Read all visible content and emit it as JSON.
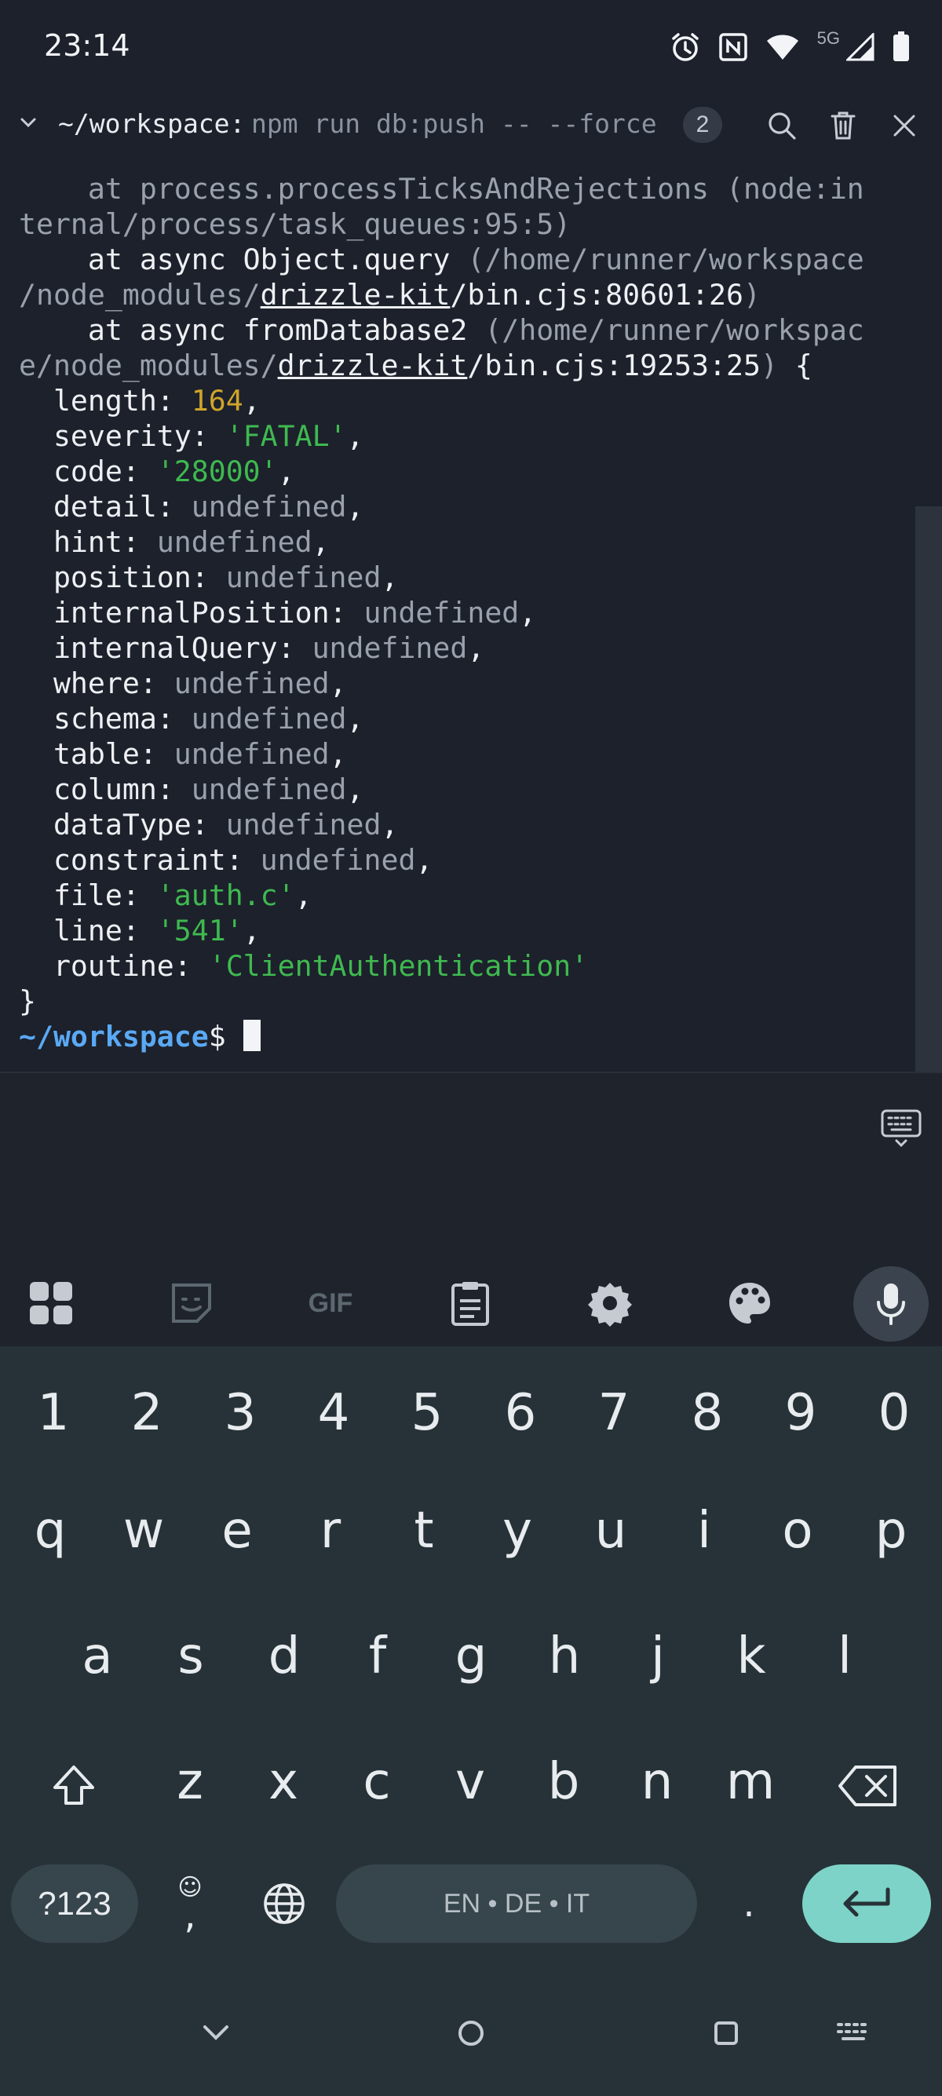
{
  "status_bar": {
    "time": "23:14",
    "network": "5G",
    "icons": [
      "alarm-icon",
      "nfc-icon",
      "wifi-icon",
      "signal-icon",
      "battery-icon"
    ]
  },
  "terminal": {
    "cwd": "~/workspace:",
    "command": "npm run db:push -- --force",
    "session_count": "2",
    "lines": {
      "l1a": "    at process.processTicksAndRejections (node:in",
      "l1b": "ternal/process/task_queues:95:5)",
      "l2a_at": "    at async Object.query ",
      "l2a_path": "(/home/runner/workspace",
      "l2b_p1": "/node_modules/",
      "l2b_link": "drizzle-kit",
      "l2b_p2": "/bin.cjs:80601:26",
      "l2b_end": ")",
      "l3a_at": "    at async fromDatabase2 ",
      "l3a_path": "(/home/runner/workspac",
      "l3b_p1": "e/node_modules/",
      "l3b_link": "drizzle-kit",
      "l3b_p2": "/bin.cjs:19253:25",
      "l3b_end": ")",
      "l3b_brace": " {"
    },
    "fields": [
      {
        "key": "  length: ",
        "value": "164",
        "kind": "num",
        "sep": ","
      },
      {
        "key": "  severity: ",
        "value": "'FATAL'",
        "kind": "str",
        "sep": ","
      },
      {
        "key": "  code: ",
        "value": "'28000'",
        "kind": "str",
        "sep": ","
      },
      {
        "key": "  detail: ",
        "value": "undefined",
        "kind": "dim",
        "sep": ","
      },
      {
        "key": "  hint: ",
        "value": "undefined",
        "kind": "dim",
        "sep": ","
      },
      {
        "key": "  position: ",
        "value": "undefined",
        "kind": "dim",
        "sep": ","
      },
      {
        "key": "  internalPosition: ",
        "value": "undefined",
        "kind": "dim",
        "sep": ","
      },
      {
        "key": "  internalQuery: ",
        "value": "undefined",
        "kind": "dim",
        "sep": ","
      },
      {
        "key": "  where: ",
        "value": "undefined",
        "kind": "dim",
        "sep": ","
      },
      {
        "key": "  schema: ",
        "value": "undefined",
        "kind": "dim",
        "sep": ","
      },
      {
        "key": "  table: ",
        "value": "undefined",
        "kind": "dim",
        "sep": ","
      },
      {
        "key": "  column: ",
        "value": "undefined",
        "kind": "dim",
        "sep": ","
      },
      {
        "key": "  dataType: ",
        "value": "undefined",
        "kind": "dim",
        "sep": ","
      },
      {
        "key": "  constraint: ",
        "value": "undefined",
        "kind": "dim",
        "sep": ","
      },
      {
        "key": "  file: ",
        "value": "'auth.c'",
        "kind": "str",
        "sep": ","
      },
      {
        "key": "  line: ",
        "value": "'541'",
        "kind": "str",
        "sep": ","
      },
      {
        "key": "  routine: ",
        "value": "'ClientAuthentication'",
        "kind": "str",
        "sep": ""
      }
    ],
    "closing_brace": "}",
    "prompt": "~/workspace",
    "prompt_symbol": "$ "
  },
  "keyboard": {
    "toolbar": [
      "apps-icon",
      "sticker-icon",
      "GIF",
      "clipboard-icon",
      "settings-icon",
      "palette-icon",
      "mic-icon"
    ],
    "gif_label": "GIF",
    "row_numbers": [
      "1",
      "2",
      "3",
      "4",
      "5",
      "6",
      "7",
      "8",
      "9",
      "0"
    ],
    "row1": [
      "q",
      "w",
      "e",
      "r",
      "t",
      "y",
      "u",
      "i",
      "o",
      "p"
    ],
    "row2": [
      "a",
      "s",
      "d",
      "f",
      "g",
      "h",
      "j",
      "k",
      "l"
    ],
    "row3": [
      "z",
      "x",
      "c",
      "v",
      "b",
      "n",
      "m"
    ],
    "symbols_label": "?123",
    "comma_label": ",",
    "period_label": ".",
    "space_label": "EN • DE • IT"
  },
  "colors": {
    "background": "#1c212b",
    "prompt": "#5aa9f5",
    "number": "#cfa52a",
    "string": "#3fb950",
    "enter_key": "#7dd3c7"
  }
}
